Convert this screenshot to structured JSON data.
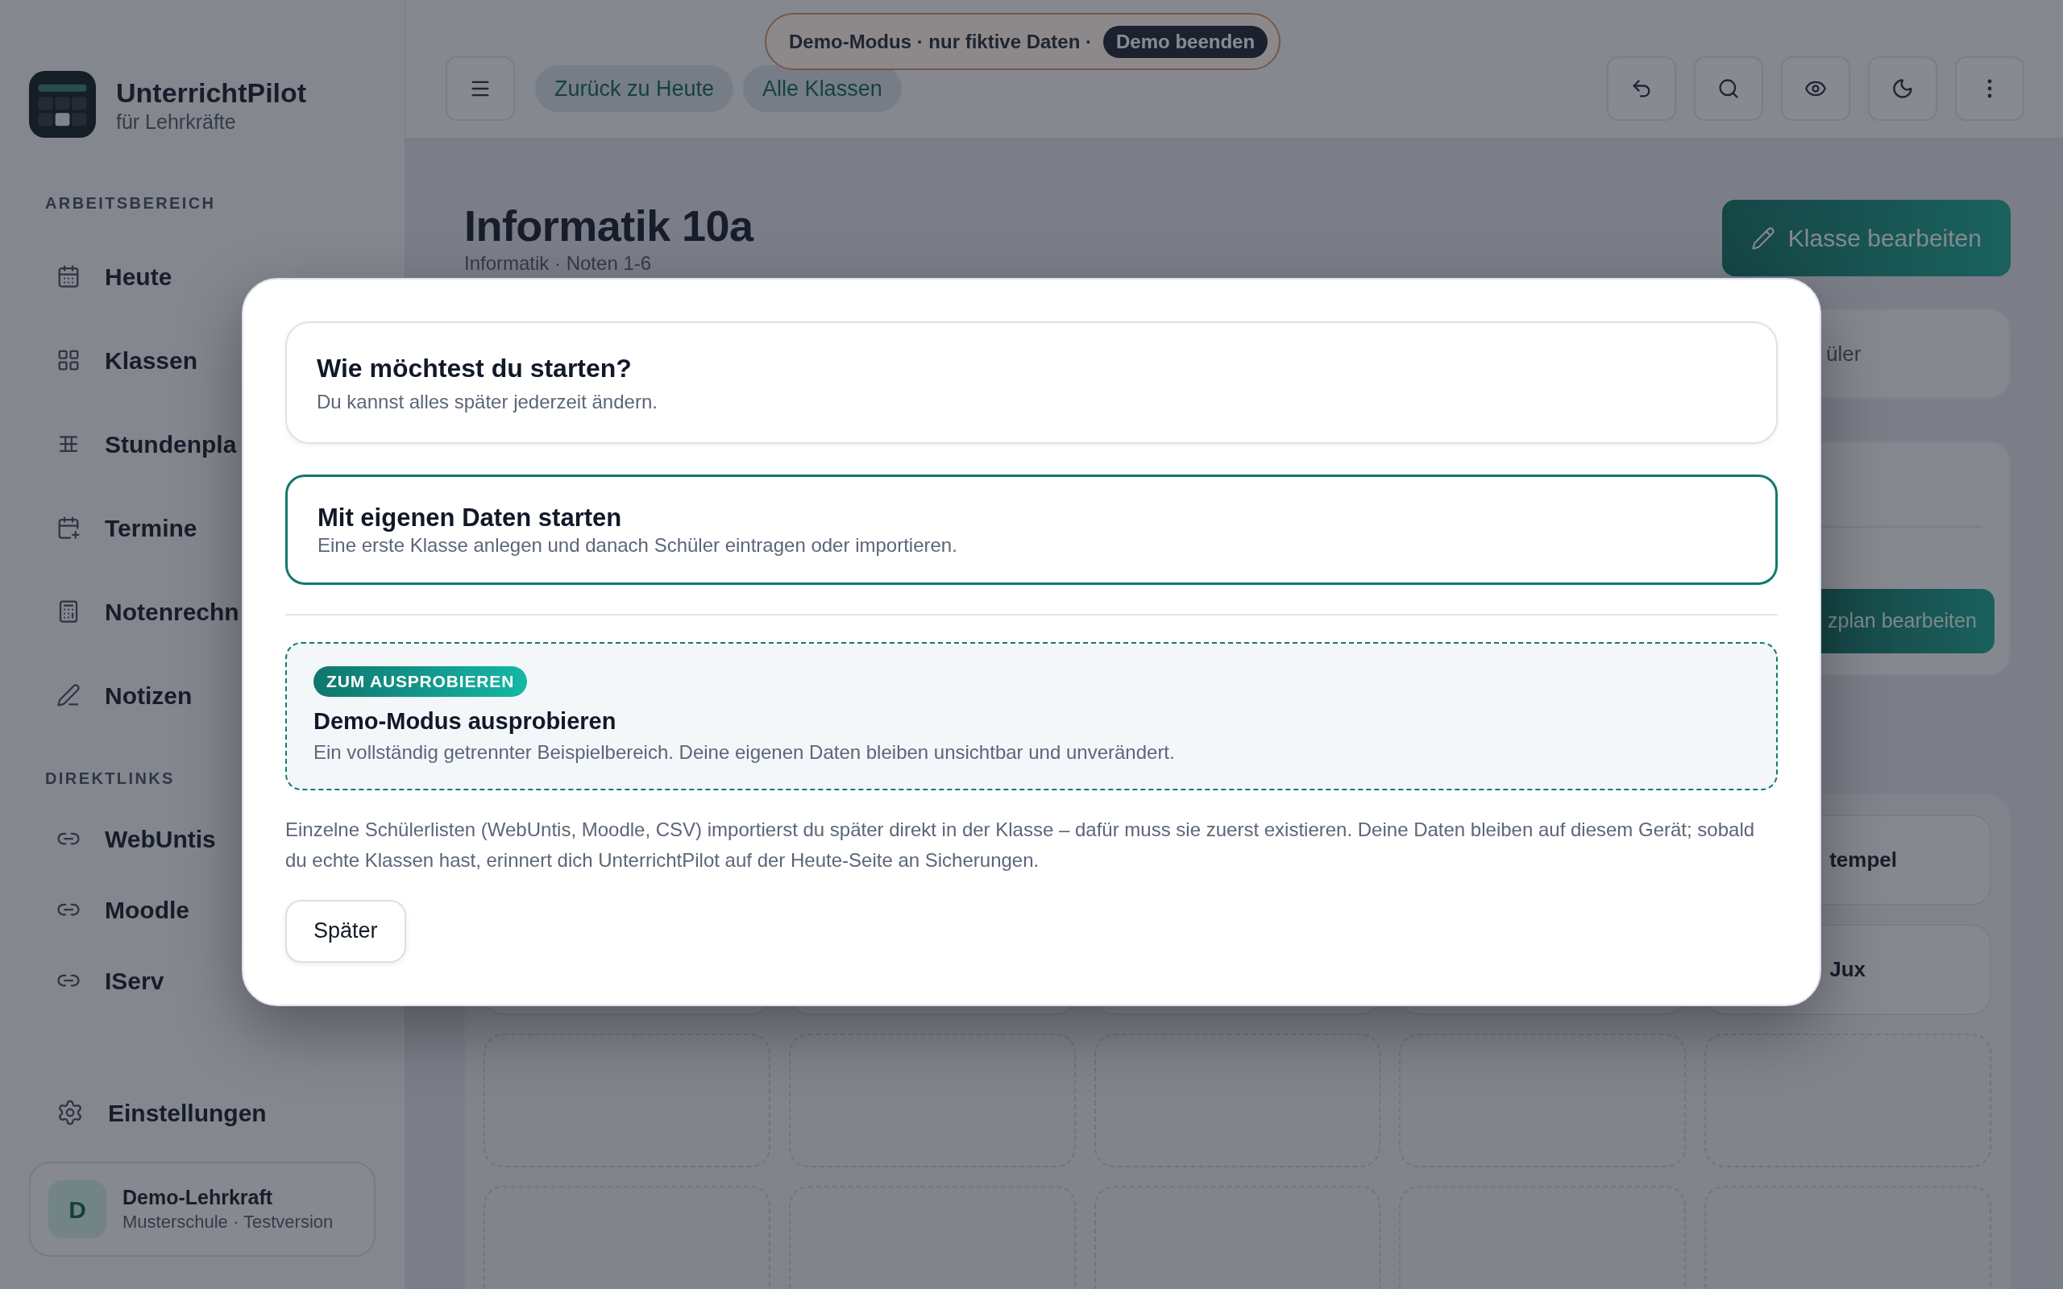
{
  "demo_banner": {
    "text": "Demo-Modus · nur fiktive Daten ·",
    "button": "Demo beenden"
  },
  "sidebar": {
    "app_name": "UnterrichtPilot",
    "app_subtitle": "für Lehrkräfte",
    "sections": [
      {
        "title": "ARBEITSBEREICH",
        "items": [
          {
            "label": "Heute"
          },
          {
            "label": "Klassen"
          },
          {
            "label": "Stundenpla"
          },
          {
            "label": "Termine"
          },
          {
            "label": "Notenrechn"
          },
          {
            "label": "Notizen"
          }
        ]
      },
      {
        "title": "DIREKTLINKS",
        "items": [
          {
            "label": "WebUntis"
          },
          {
            "label": "Moodle"
          },
          {
            "label": "IServ"
          }
        ]
      }
    ],
    "settings": "Einstellungen",
    "user": {
      "initial": "D",
      "name": "Demo-Lehrkraft",
      "detail": "Musterschule · Testversion"
    }
  },
  "toolbar": {
    "nav_pills": [
      "Zurück zu Heute",
      "Alle Klassen"
    ]
  },
  "page": {
    "title": "Informatik 10a",
    "subtitle": "Informatik · Noten 1-6",
    "edit_button": "Klasse bearbeiten",
    "card_fragment": "üler",
    "plan_button_fragment": "zplan bearbeiten",
    "tiles": [
      {
        "text": "tempel"
      },
      {
        "text": "Jux"
      }
    ]
  },
  "dialog": {
    "header": {
      "title": "Wie möchtest du starten?",
      "subtitle": "Du kannst alles später jederzeit ändern."
    },
    "options": [
      {
        "kind": "primary",
        "title": "Mit eigenen Daten starten",
        "description": "Eine erste Klasse anlegen und danach Schüler eintragen oder importieren.",
        "selected": true
      },
      {
        "kind": "demo",
        "badge": "ZUM AUSPROBIEREN",
        "title": "Demo-Modus ausprobieren",
        "description": "Ein vollständig getrennter Beispielbereich. Deine eigenen Daten bleiben unsichtbar und unverändert.",
        "selected": false
      }
    ],
    "note": "Einzelne Schülerlisten (WebUntis, Moodle, CSV) importierst du später direkt in der Klasse – dafür muss sie zuerst existieren. Deine Daten bleiben auf diesem Gerät; sobald du echte Klassen hast, erinnert dich UnterrichtPilot auf der Heute-Seite an Sicherungen.",
    "later_button": "Später"
  }
}
